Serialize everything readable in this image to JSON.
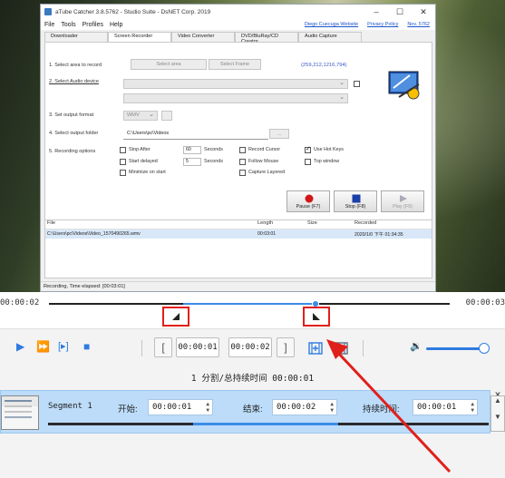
{
  "app_window": {
    "title": "aTube Catcher 3.8.5762 - Studio Suite - DsNET Corp. 2019",
    "menu": [
      "File",
      "Tools",
      "Profiles",
      "Help"
    ],
    "links": [
      "Diego Cuecuga Website",
      "Privacy Policy",
      "Nov. 5762"
    ],
    "tabs": [
      "Downloader",
      "Screen Recorder",
      "Video Converter",
      "DVD/BluRay/CD Creator",
      "Audio Capture"
    ],
    "active_tab": "Screen Recorder",
    "labels": {
      "select_area": "1. Select area to record",
      "select_audio": "2. Select Audio device",
      "output_format": "3. Set output format",
      "output_folder": "4. Select output folder",
      "recording_options": "5. Recording options"
    },
    "select_area_button": "Select area",
    "select_frame_button": "Select Frame",
    "coords": "(259,212,1216,794)",
    "format_value": "WMV",
    "folder_value": "C:\\Users\\pc\\Videos",
    "options": {
      "stop_after": "Stop After",
      "stop_after_value": "60",
      "seconds1": "Seconds",
      "start_delayed": "Start delayed",
      "start_delayed_value": "5",
      "seconds2": "Seconds",
      "minimize": "Minimize on start",
      "record_cursor": "Record Cursor",
      "follow_mouse": "Follow Mouse",
      "capture_layered": "Capture Layered",
      "use_hot_keys": "Use Hot Keys",
      "top_window": "Top window"
    },
    "buttons": {
      "pause": "Pause (F7)",
      "stop": "Stop (F8)",
      "play": "Play (F9)"
    },
    "list": {
      "headers": [
        "File",
        "Length",
        "Size",
        "Recorded"
      ],
      "rows": [
        [
          "C:\\Users\\pc\\Videos\\Video_1570490265.wmv",
          "00:03:01",
          "",
          "2020/1/0 下午 01:34:35"
        ]
      ]
    },
    "status": "Recording, Time elapsed: [00:03:01]"
  },
  "timeline": {
    "start_time": "00:00:02",
    "end_time": "00:00:03",
    "selection_start_fraction": 0.33,
    "selection_end_fraction": 0.66
  },
  "controls": {
    "in_time": "00:00:01",
    "out_time": "00:00:02",
    "volume_fraction": 0.9
  },
  "summary": "1 分割/总持续时间 00:00:01",
  "segment": {
    "name": "Segment 1",
    "start_label": "开始:",
    "start_value": "00:00:01",
    "end_label": "结束:",
    "end_value": "00:00:02",
    "duration_label": "持续时间:",
    "duration_value": "00:00:01"
  },
  "colors": {
    "accent": "#2e7be0",
    "highlight_box": "#e0201a",
    "segment_bg": "#bcdcfa"
  }
}
